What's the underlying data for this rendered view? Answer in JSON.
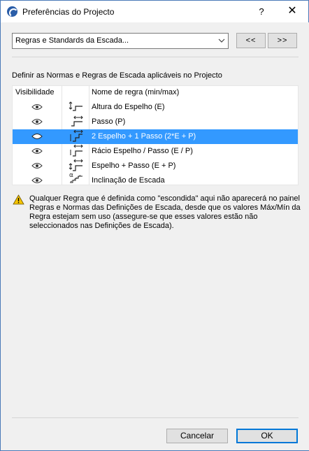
{
  "window": {
    "title": "Preferências do Projecto",
    "help_label": "?",
    "close_label": "✕"
  },
  "selector": {
    "value": "Regras e Standards da Escada...",
    "prev_label": "<<",
    "next_label": ">>"
  },
  "description": "Definir as Normas e Regras de Escada aplicáveis no Projecto",
  "table": {
    "headers": {
      "visibility": "Visibilidade",
      "name": "Nome de regra (min/max)"
    },
    "rows": [
      {
        "name": "Altura do Espelho (E)",
        "icon": "riser-height-icon",
        "visible": true,
        "selected": false
      },
      {
        "name": "Passo (P)",
        "icon": "going-icon",
        "visible": true,
        "selected": false
      },
      {
        "name": "2 Espelho + 1 Passo (2*E + P)",
        "icon": "two-riser-going-icon",
        "visible": true,
        "selected": true
      },
      {
        "name": "Rácio Espelho / Passo (E / P)",
        "icon": "riser-going-ratio-icon",
        "visible": true,
        "selected": false
      },
      {
        "name": "Espelho + Passo (E + P)",
        "icon": "riser-plus-going-icon",
        "visible": true,
        "selected": false
      },
      {
        "name": "Inclinação de Escada",
        "icon": "stair-pitch-icon",
        "visible": true,
        "selected": false
      }
    ]
  },
  "warning": {
    "icon": "warning-icon",
    "text": "Qualquer Regra que é definida como \"escondida\" aqui não aparecerá no painel Regras e Normas das Definições de Escada, desde que os valores Máx/Mín da Regra estejam sem uso (assegure-se que esses valores estão não seleccionados nas Definições de Escada)."
  },
  "buttons": {
    "cancel": "Cancelar",
    "ok": "OK"
  },
  "colors": {
    "selection": "#3399ff",
    "accent": "#0078d7",
    "warning": "#f5c400"
  }
}
